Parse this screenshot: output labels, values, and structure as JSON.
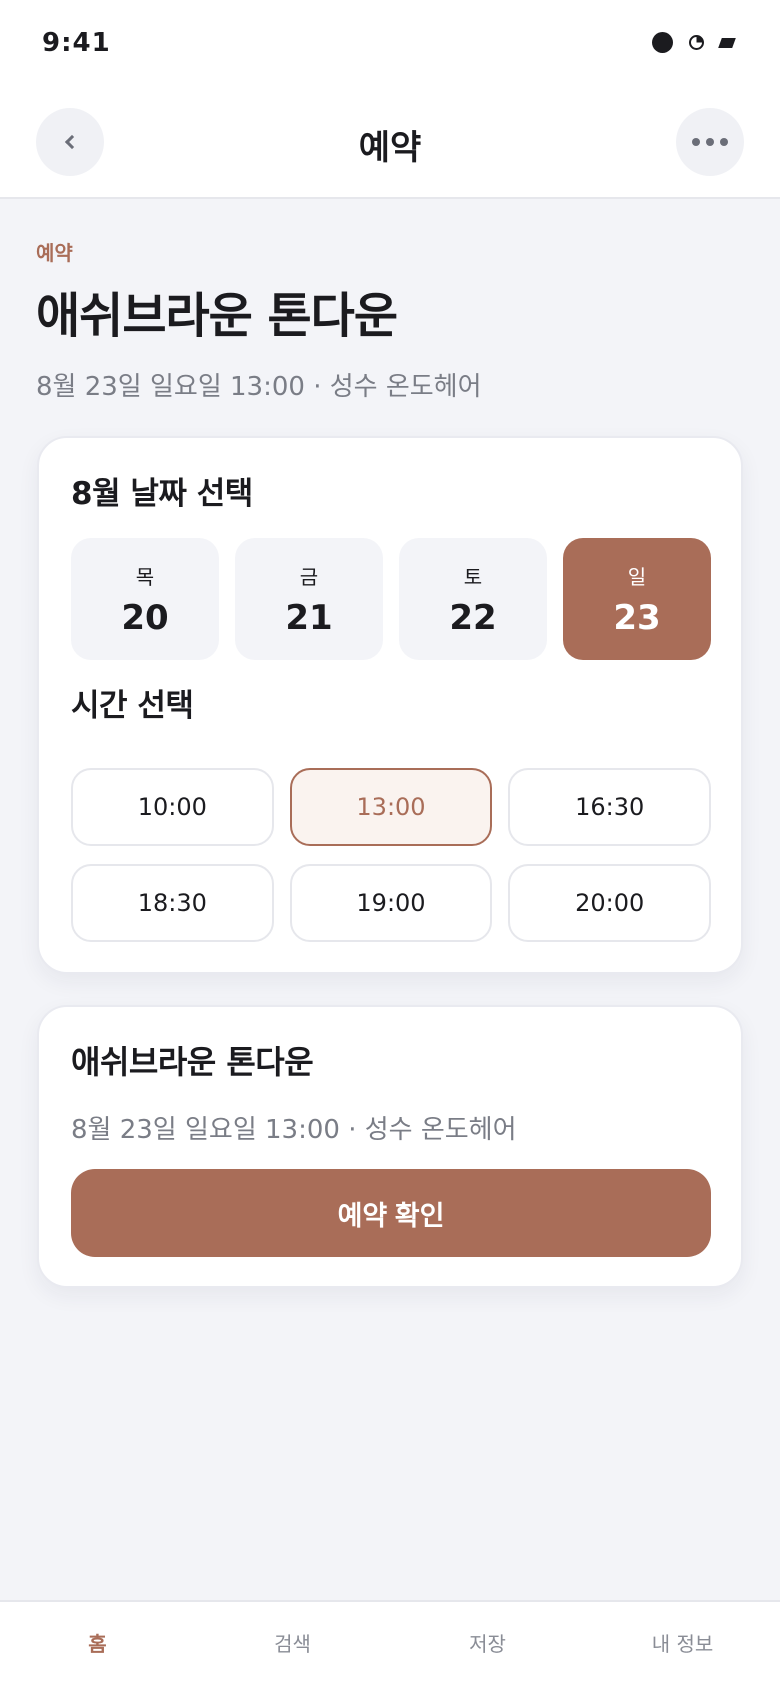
{
  "status_bar": {
    "time": "9:41"
  },
  "header": {
    "title": "예약"
  },
  "hero": {
    "eyebrow": "예약",
    "title": "애쉬브라운 톤다운",
    "subtitle": "8월 23일 일요일 13:00 · 성수 온도헤어"
  },
  "date_picker": {
    "title": "8월 날짜 선택",
    "dates": [
      {
        "dow": "목",
        "day": "20",
        "selected": false
      },
      {
        "dow": "금",
        "day": "21",
        "selected": false
      },
      {
        "dow": "토",
        "day": "22",
        "selected": false
      },
      {
        "dow": "일",
        "day": "23",
        "selected": true
      }
    ]
  },
  "time_picker": {
    "title": "시간 선택",
    "slots": [
      {
        "label": "10:00",
        "selected": false
      },
      {
        "label": "13:00",
        "selected": true
      },
      {
        "label": "16:30",
        "selected": false
      },
      {
        "label": "18:30",
        "selected": false
      },
      {
        "label": "19:00",
        "selected": false
      },
      {
        "label": "20:00",
        "selected": false
      }
    ]
  },
  "summary": {
    "title": "애쉬브라운 톤다운",
    "subtitle": "8월 23일 일요일 13:00 · 성수 온도헤어",
    "confirm_label": "예약 확인"
  },
  "bottom_nav": {
    "items": [
      {
        "label": "홈",
        "active": true
      },
      {
        "label": "검색",
        "active": false
      },
      {
        "label": "저장",
        "active": false
      },
      {
        "label": "내 정보",
        "active": false
      }
    ]
  },
  "colors": {
    "accent": "#A96D58",
    "background": "#F3F4F8",
    "text": "#1B1B1F",
    "muted": "#7A7D86"
  },
  "icons": {
    "back": "chevron-left-icon",
    "more": "more-horizontal-icon",
    "signal": "signal-icon",
    "wifi": "wifi-icon",
    "battery": "battery-icon"
  }
}
